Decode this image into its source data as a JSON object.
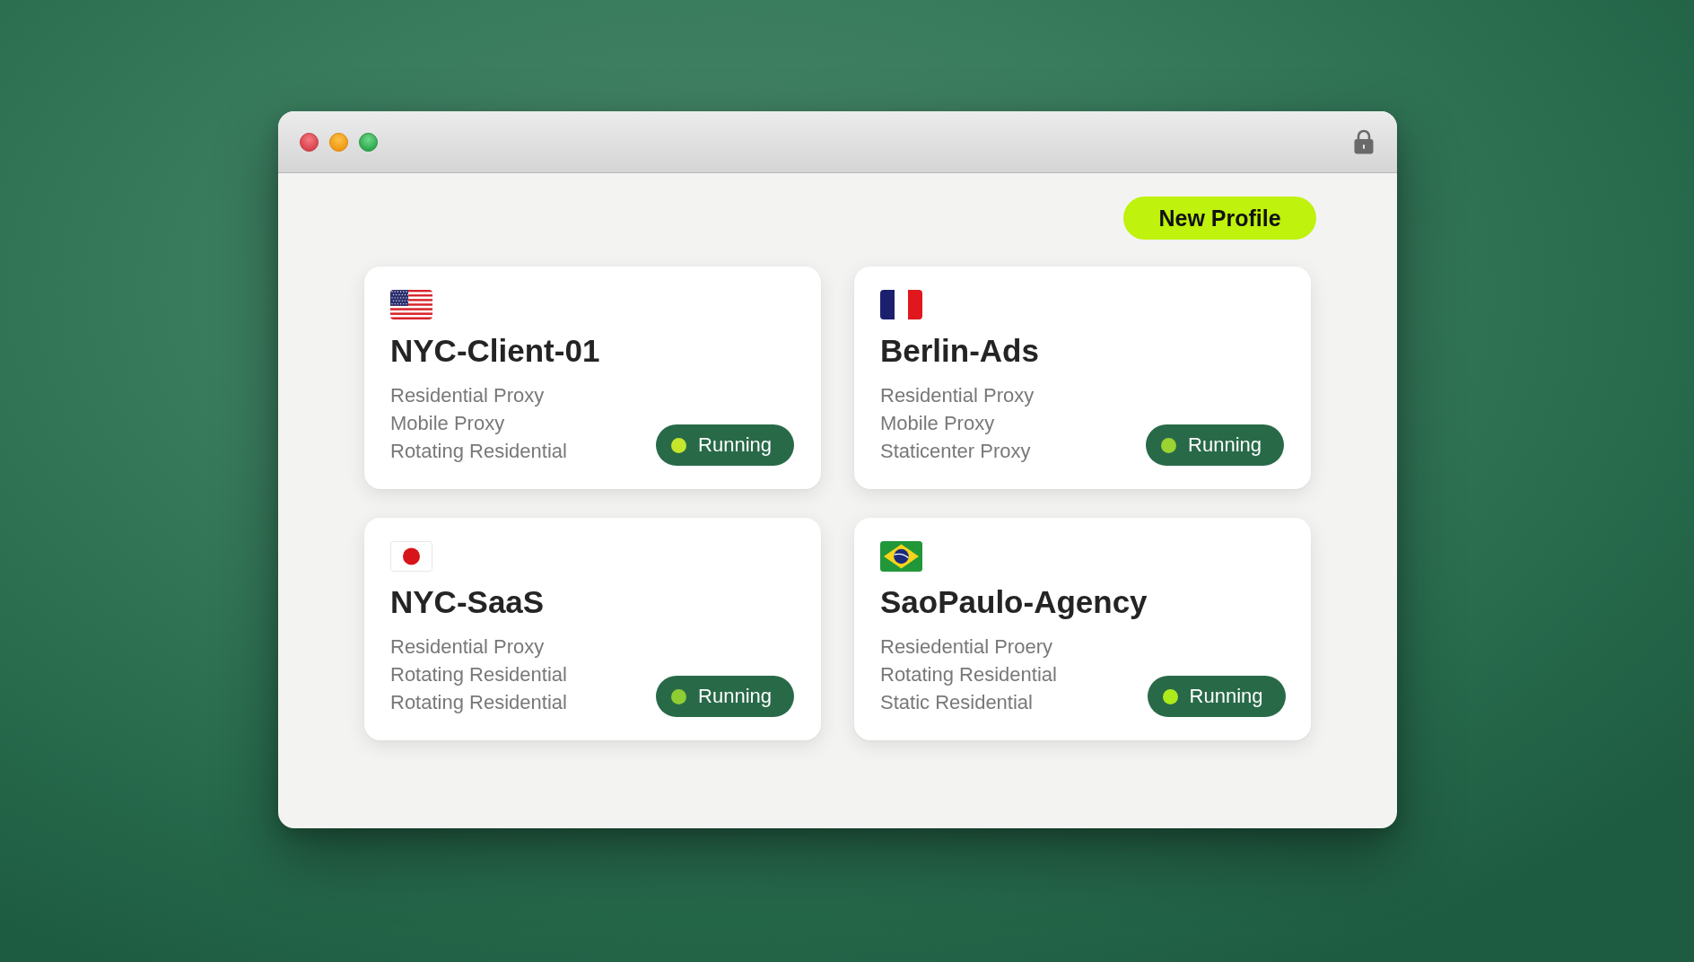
{
  "toolbar": {
    "new_profile_button": "New Profile"
  },
  "profiles": [
    {
      "flag": {
        "kind": "usa"
      },
      "name": "NYC-Client-01",
      "proxies": [
        "Residential Proxy",
        "Mobile Proxy",
        "Rotating Residential"
      ],
      "status": {
        "label": "Running",
        "color": "#c5e62b"
      }
    },
    {
      "flag": {
        "kind": "france"
      },
      "name": "Berlin-Ads",
      "proxies": [
        "Residential Proxy",
        "Mobile Proxy",
        "Staticenter Proxy"
      ],
      "status": {
        "label": "Running",
        "color": "#9ad332"
      }
    },
    {
      "flag": {
        "kind": "japan"
      },
      "name": "NYC-SaaS",
      "proxies": [
        "Residential Proxy",
        "Rotating Residential",
        "Rotating Residential"
      ],
      "status": {
        "label": "Running",
        "color": "#8fcd35"
      }
    },
    {
      "flag": {
        "kind": "brazil"
      },
      "name": "SaoPaulo-Agency",
      "proxies": [
        "Resiedential Proery",
        "Rotating Residential",
        "Static Residential"
      ],
      "status": {
        "label": "Running",
        "color": "#aeea1c"
      }
    }
  ]
}
